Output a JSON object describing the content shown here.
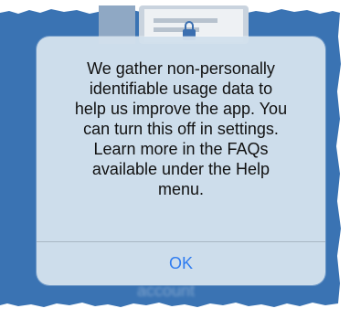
{
  "dialog": {
    "message": "We gather non-personally\nidentifiable usage data to\nhelp us improve the app. You\ncan turn this off in settings.\nLearn more in the FAQs\navailable under the Help\nmenu.",
    "ok_label": "OK"
  },
  "background": {
    "behind_text": "account"
  },
  "colors": {
    "app_background": "#3a73b3",
    "alert_background": "#d2e0ec",
    "button_text": "#2f7cf0"
  },
  "icons": {
    "illustration": "phone-lock-illustration"
  }
}
